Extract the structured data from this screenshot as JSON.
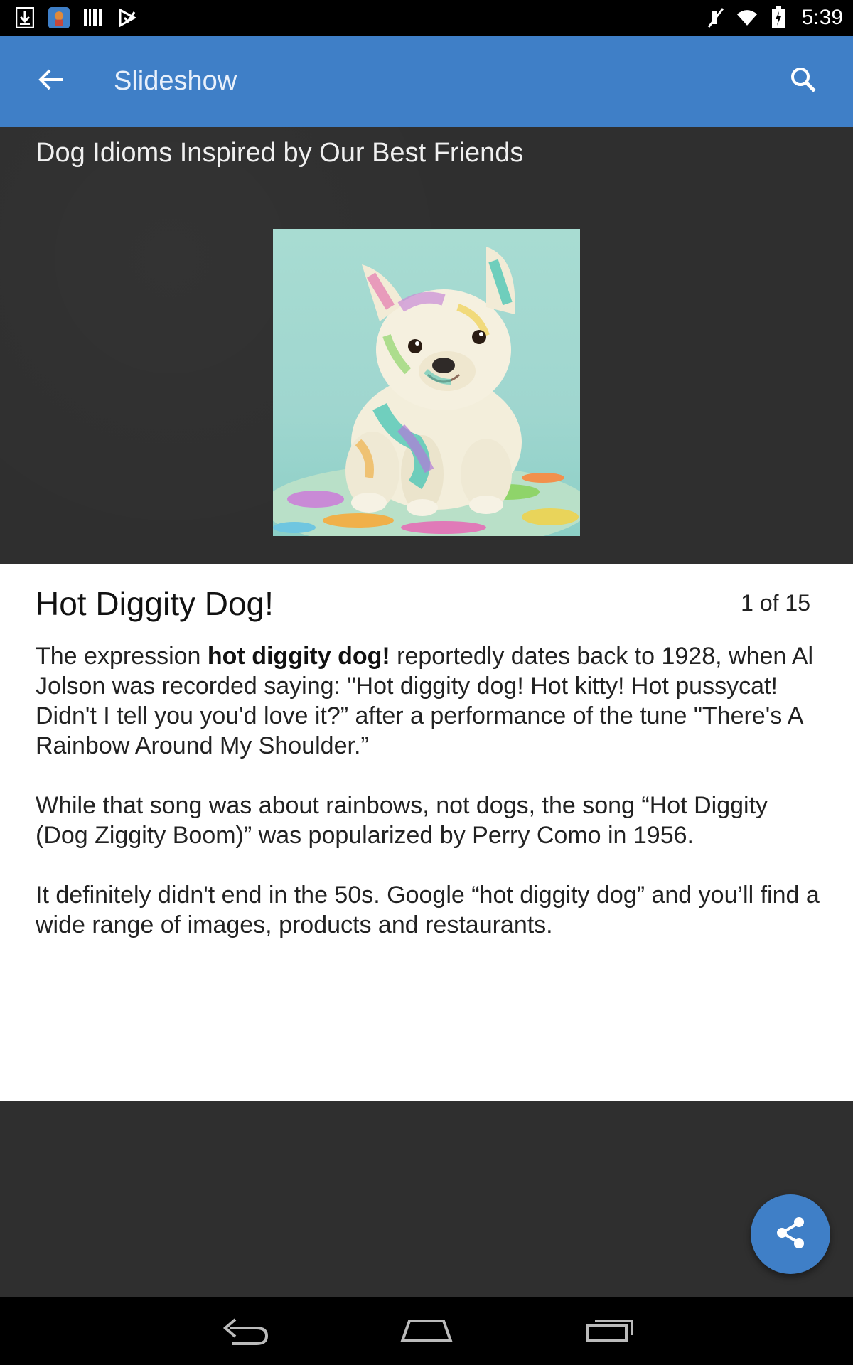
{
  "status_bar": {
    "time": "5:39",
    "left_icons": [
      "download-icon",
      "app-notification-icon",
      "barcode-icon",
      "play-store-icon"
    ],
    "right_icons": [
      "mute-icon",
      "wifi-icon",
      "battery-icon"
    ]
  },
  "app_bar": {
    "title": "Slideshow",
    "back_icon": "arrow-back-icon",
    "search_icon": "search-icon",
    "color": "#3f7fc7"
  },
  "hero": {
    "slideshow_title": "Dog Idioms Inspired by Our Best Friends",
    "image": "paint-splattered-french-bulldog-puppy"
  },
  "slide": {
    "heading": "Hot Diggity Dog!",
    "counter": "1 of 15",
    "paragraph1_before": "The expression ",
    "paragraph1_bold": "hot diggity dog!",
    "paragraph1_after": " reportedly dates back to 1928, when Al Jolson was recorded saying: \"Hot diggity dog! Hot kitty! Hot pussycat! Didn't I tell you you'd love it?” after a performance of the tune \"There's A Rainbow Around My Shoulder.”",
    "paragraph2": "While that song was about rainbows, not dogs, the song “Hot Diggity (Dog Ziggity Boom)” was popularized by Perry Como in 1956.",
    "paragraph3": "It definitely didn't end in the 50s. Google “hot diggity dog” and you’ll find a wide range of images, products and restaurants."
  },
  "fab": {
    "icon": "share-icon",
    "color": "#3f7fc7"
  },
  "nav_bar": {
    "icons": [
      "back-nav-icon",
      "home-nav-icon",
      "recents-nav-icon"
    ]
  }
}
